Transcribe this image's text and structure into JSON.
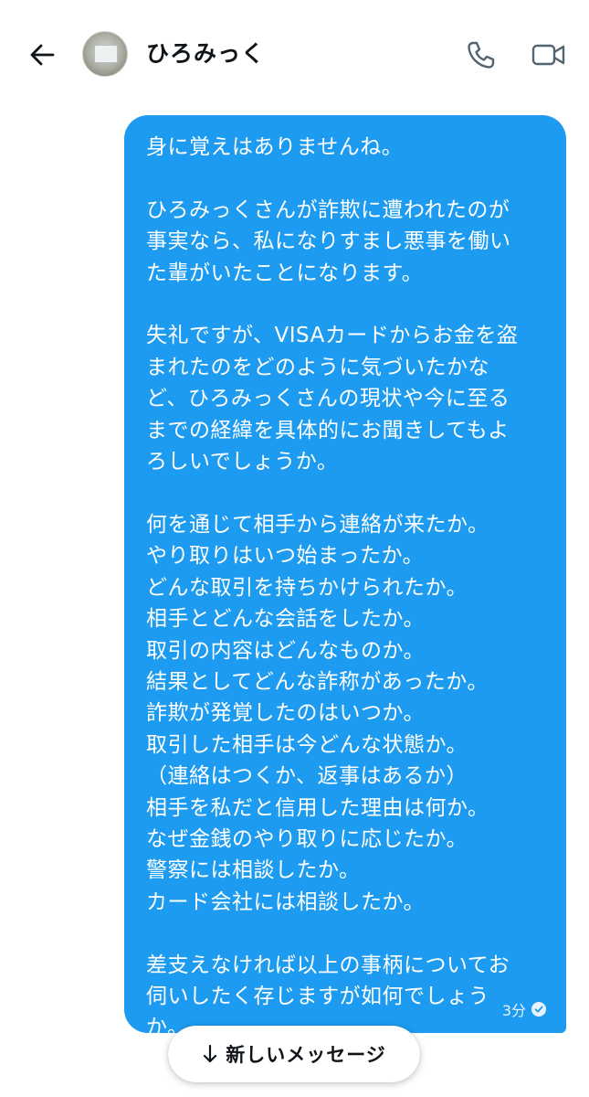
{
  "header": {
    "contact_name": "ひろみっく"
  },
  "icons": {
    "back": "arrow-left-icon",
    "call": "phone-icon",
    "video": "video-camera-icon",
    "read_receipt": "check-circle-icon",
    "new_message": "arrow-down-icon"
  },
  "message": {
    "text": "身に覚えはありませんね。\n\nひろみっくさんが詐欺に遭われたのが\n事実なら、私になりすまし悪事を働い\nた輩がいたことになります。\n\n失礼ですが、VISAカードからお金を盗\nまれたのをどのように気づいたかな\nど、ひろみっくさんの現状や今に至る\nまでの経緯を具体的にお聞きしてもよ\nろしいでしょうか。\n\n何を通じて相手から連絡が来たか。\nやり取りはいつ始まったか。\nどんな取引を持ちかけられたか。\n相手とどんな会話をしたか。\n取引の内容はどんなものか。\n結果としてどんな詐称があったか。\n詐欺が発覚したのはいつか。\n取引した相手は今どんな状態か。\n（連絡はつくか、返事はあるか）\n相手を私だと信用した理由は何か。\nなぜ金銭のやり取りに応じたか。\n警察には相談したか。\nカード会社には相談したか。\n\n差支えなければ以上の事柄についてお\n伺いしたく存じますが如何でしょう\nか。",
    "timestamp": "3分"
  },
  "new_message_button": {
    "label": "新しいメッセージ"
  },
  "colors": {
    "bubble": "#1d9bf0",
    "bubble_text": "#ffffff",
    "text_primary": "#0f1419",
    "icon_gray": "#536471"
  }
}
